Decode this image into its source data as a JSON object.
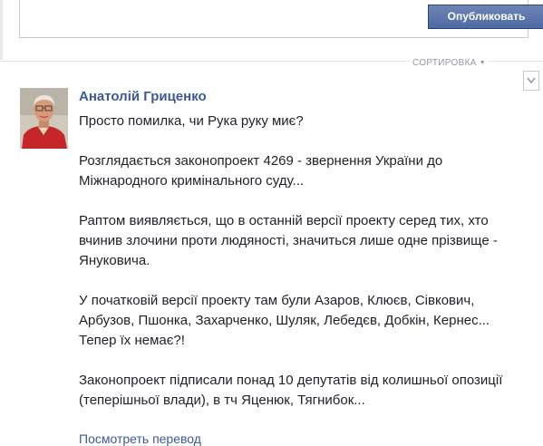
{
  "composer": {
    "publish_label": "Опубликовать"
  },
  "sort": {
    "label": "СОРТИРОВКА"
  },
  "post": {
    "author": "Анатолій Гриценко",
    "paragraphs": [
      "Просто помилка, чи Рука руку миє?",
      "Розглядається законопроект 4269 - звернення України до\nМіжнародного кримінального суду...",
      "Раптом виявляється, що в останній версії проекту серед тих, хто\nвчинив злочини проти людяності, значиться лише одне прізвище -\nЯнуковича.",
      "У початковій версії проекту там були Азаров, Клюєв, Сівкович,\nАрбузов, Пшонка, Захарченко, Шуляк, Лебедєв, Добкін, Кернес...\nТепер їх немає?!",
      "Законопроект підписали понад 10 депутатів від колишньої опозиції\n(теперішньої влади), в тч Яценюк, Тягнибок..."
    ],
    "translate_label": "Посмотреть перевод"
  },
  "colors": {
    "link": "#3b5998",
    "button": "#5b74a8",
    "text": "#1d2129",
    "muted": "#9197a3"
  }
}
